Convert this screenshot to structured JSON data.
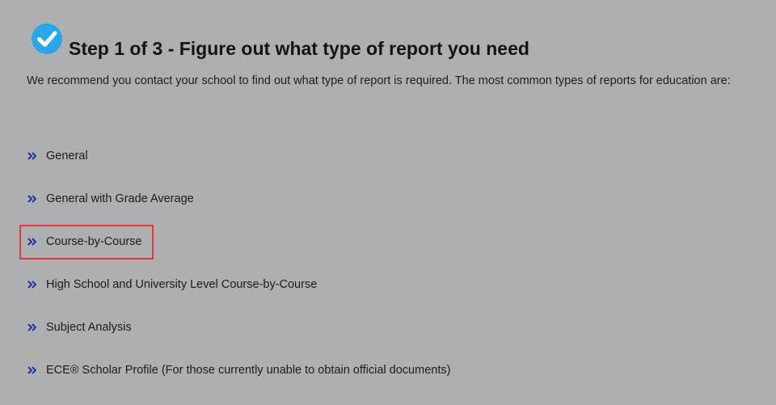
{
  "header": {
    "check_icon": "checkmark-circle-icon",
    "check_icon_color": "#2aa7e8",
    "title": "Step 1 of 3 - Figure out what type of report you need"
  },
  "intro": {
    "text": "We recommend you contact your school to find out what type of report is required. The most common types of reports for education are:"
  },
  "report_types": {
    "bullet_icon": "double-chevron-right-icon",
    "bullet_color": "#1f2fa8",
    "items": [
      {
        "label": "General"
      },
      {
        "label": "General with Grade Average"
      },
      {
        "label": "Course-by-Course"
      },
      {
        "label": "High School and University Level Course-by-Course"
      },
      {
        "label": "Subject Analysis"
      },
      {
        "label": "ECE® Scholar Profile (For those currently unable to obtain official documents)"
      }
    ]
  },
  "highlight": {
    "target": "Course-by-Course",
    "color": "#e23a3a"
  }
}
